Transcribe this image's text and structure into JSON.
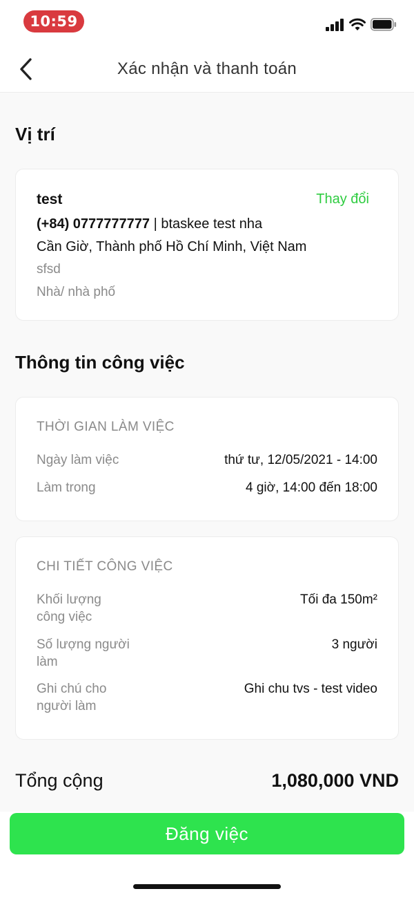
{
  "status_bar": {
    "time": "10:59",
    "time_pill_color": "#d93a3f",
    "icons": [
      "signal-icon",
      "wifi-icon",
      "battery-icon"
    ]
  },
  "header": {
    "title": "Xác nhận và thanh toán",
    "back_icon": "chevron-left-icon"
  },
  "location": {
    "section_title": "Vị trí",
    "name": "test",
    "change_label": "Thay đổi",
    "phone": "(+84) 0777777777",
    "separator": " | ",
    "contact_note": "btaskee test nha",
    "address": "Cần Giờ, Thành phố Hồ Chí Minh, Việt Nam",
    "detail": "sfsd",
    "home_type": "Nhà/ nhà phố"
  },
  "job_info": {
    "section_title": "Thông tin công việc",
    "work_time": {
      "heading": "THỜI GIAN LÀM VIỆC",
      "rows": [
        {
          "label": "Ngày làm việc",
          "value": "thứ tư, 12/05/2021 - 14:00"
        },
        {
          "label": "Làm trong",
          "value": "4 giờ, 14:00 đến 18:00"
        }
      ]
    },
    "job_detail": {
      "heading": "CHI TIẾT CÔNG VIỆC",
      "rows": [
        {
          "label_line1": "Khối lượng",
          "label_line2": "công việc",
          "value": "Tối đa 150m²"
        },
        {
          "label_line1": "Số lượng người",
          "label_line2": "làm",
          "value": "3 người"
        },
        {
          "label_line1": "Ghi chú cho",
          "label_line2": "người làm",
          "value": "Ghi chu tvs - test video"
        }
      ]
    }
  },
  "total": {
    "label": "Tổng cộng",
    "value": "1,080,000 VND"
  },
  "action": {
    "post_label": "Đăng việc",
    "accent_color": "#2ee34e",
    "link_color": "#2ecc40"
  }
}
